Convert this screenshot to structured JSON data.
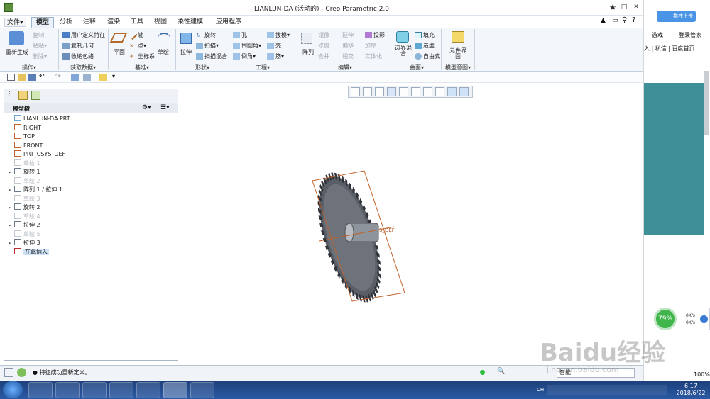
{
  "window": {
    "title": "LIANLUN-DA (活动的) - Creo Parametric 2.0",
    "minimize": "—",
    "maximize": "□",
    "close": "✕"
  },
  "menu": {
    "file": "文件▾",
    "tabs": [
      "模型",
      "分析",
      "注释",
      "渲染",
      "工具",
      "视图",
      "柔性建模",
      "应用程序"
    ],
    "active_tab": "模型"
  },
  "ribbon": {
    "ops": {
      "regenerate": "重新生成",
      "copy": "复制",
      "paste": "粘贴▾",
      "delete": "删除▾",
      "label": "操作▾"
    },
    "get": {
      "udf": "用户定义特征",
      "copy_geom": "复制几何",
      "shrinkwrap": "收缩包络",
      "label": "获取数据▾"
    },
    "datum": {
      "plane": "平面",
      "axis": "轴",
      "point": "点▾",
      "csys": "坐标系",
      "sketch": "草绘",
      "label": "基准▾"
    },
    "shape": {
      "extrude": "拉伸",
      "revolve": "旋转",
      "sweep": "扫描▾",
      "swept_blend": "扫描混合",
      "label": "形状▾"
    },
    "eng": {
      "hole": "孔",
      "round": "倒圆角▾",
      "chamfer": "倒角▾",
      "draft": "拔模▾",
      "shell": "壳",
      "rib": "筋▾",
      "label": "工程▾"
    },
    "edit": {
      "pattern": "阵列",
      "mirror": "镜像",
      "trim": "修剪",
      "merge": "合并",
      "extend": "延伸",
      "offset": "偏移",
      "intersect": "相交",
      "project": "投影",
      "thicken": "加厚",
      "solidify": "实体化",
      "label": "编辑▾"
    },
    "surface": {
      "boundary": "边界混合",
      "fill": "填充",
      "style": "造型",
      "freestyle": "自由式",
      "label": "曲面▾"
    },
    "intent": {
      "component": "元件界面",
      "label": "模型意图▾"
    }
  },
  "panel": {
    "header": "模型树"
  },
  "tree": [
    {
      "label": "LIANLUN-DA.PRT",
      "dim": false,
      "icon": "part-icon",
      "expand": ""
    },
    {
      "label": "RIGHT",
      "dim": false,
      "icon": "datum-plane-icon",
      "expand": ""
    },
    {
      "label": "TOP",
      "dim": false,
      "icon": "datum-plane-icon",
      "expand": ""
    },
    {
      "label": "FRONT",
      "dim": false,
      "icon": "datum-plane-icon",
      "expand": ""
    },
    {
      "label": "PRT_CSYS_DEF",
      "dim": false,
      "icon": "csys-icon",
      "expand": ""
    },
    {
      "label": "草绘 1",
      "dim": true,
      "icon": "sketch-icon",
      "expand": ""
    },
    {
      "label": "旋转 1",
      "dim": false,
      "icon": "revolve-icon",
      "expand": "▸"
    },
    {
      "label": "草绘 2",
      "dim": true,
      "icon": "sketch-icon",
      "expand": ""
    },
    {
      "label": "阵列 1 / 拉伸 1",
      "dim": false,
      "icon": "pattern-icon",
      "expand": "▸"
    },
    {
      "label": "草绘 3",
      "dim": true,
      "icon": "sketch-icon",
      "expand": ""
    },
    {
      "label": "旋转 2",
      "dim": false,
      "icon": "revolve-icon",
      "expand": "▸"
    },
    {
      "label": "草绘 4",
      "dim": true,
      "icon": "sketch-icon",
      "expand": ""
    },
    {
      "label": "拉伸 2",
      "dim": false,
      "icon": "extrude-icon",
      "expand": "▸"
    },
    {
      "label": "草绘 5",
      "dim": true,
      "icon": "sketch-icon",
      "expand": ""
    },
    {
      "label": "拉伸 3",
      "dim": false,
      "icon": "extrude-icon",
      "expand": "▸"
    },
    {
      "label": "在此插入",
      "dim": false,
      "icon": "insert-arrow-icon",
      "expand": ""
    }
  ],
  "graphics": {
    "csys_label": "S_DEF"
  },
  "status": {
    "message": "特征成功重新定义。",
    "filter": "智能"
  },
  "right": {
    "upload": "拖拽上传",
    "game": "游戏",
    "login": "登录管家",
    "links": "入 | 私信 | 百度首页",
    "gauge": "79%",
    "rate_up": "0K/s",
    "rate_down": "0K/s",
    "zoom": "100%"
  },
  "taskbar": {
    "time": "6:17",
    "date": "2018/6/22",
    "lang": "CH"
  },
  "watermark": {
    "text": "Baidu经验",
    "url": "jingyan.baidu.com"
  }
}
